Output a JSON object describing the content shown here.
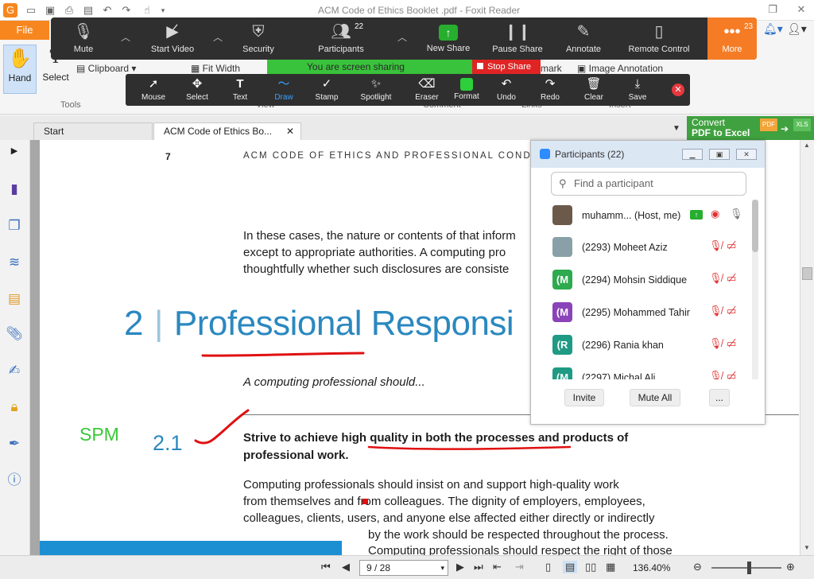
{
  "app": {
    "title": "ACM Code of Ethics Booklet .pdf - Foxit Reader",
    "window_controls": [
      "–",
      "❐",
      "×"
    ]
  },
  "ribbon": {
    "file_label": "File",
    "hand_label": "Hand",
    "select_label": "Select",
    "tools_group": "Tools",
    "view_group": "View",
    "comment_group": "Comment",
    "links_group": "Links",
    "insert_group": "Insert",
    "clipboard_label": "Clipboard",
    "fit_width_label": "Fit Width",
    "bookmark_label": "mark",
    "image_annotation_label": "Image Annotation"
  },
  "zoom": {
    "mute": "Mute",
    "start_video": "Start Video",
    "security": "Security",
    "participants": "Participants",
    "participants_count": "22",
    "new_share": "New Share",
    "pause_share": "Pause Share",
    "annotate": "Annotate",
    "remote_control": "Remote Control",
    "more": "More",
    "more_count": "23",
    "sharing_banner": "You are screen sharing",
    "stop_share": "Stop Share"
  },
  "annotation_toolbar": {
    "tools": [
      "Mouse",
      "Select",
      "Text",
      "Draw",
      "Stamp",
      "Spotlight",
      "Eraser",
      "Format",
      "Undo",
      "Redo",
      "Clear",
      "Save"
    ],
    "active": "Draw"
  },
  "tabs": {
    "start": "Start",
    "doc": "ACM Code of Ethics Bo..."
  },
  "convert_banner": {
    "line1": "Convert",
    "line2": "PDF to Excel",
    "pdf_badge": "PDF",
    "xls_badge": "XLS"
  },
  "document": {
    "page_number": "7",
    "running_head": "ACM CODE OF ETHICS AND PROFESSIONAL COND",
    "para1": [
      "In these cases, the nature or contents of that inform",
      "except to appropriate authorities. A computing pro",
      "thoughtfully whether such disclosures are consiste"
    ],
    "heading_number": "2",
    "heading_text": "Professional Responsi",
    "intro": "A computing professional should...",
    "section_number": "2.1",
    "section_title_line1_a": "Strive to achieve ",
    "section_title_line1_b": "high quality in both the processes",
    "section_title_line1_c": " and products of",
    "section_title_line2": "professional work.",
    "body": [
      "Computing professionals should insist on and support high-quality work",
      "from themselves and from colleagues. The dignity of employers, employees,",
      "colleagues, clients, users, and anyone else affected either directly or indirectly",
      "by the work should be respected throughout the process.",
      "Computing professionals should respect the right of those"
    ],
    "handwritten_note": "SPM",
    "ink_color": "#e01010",
    "note_color": "#37c837"
  },
  "participants_panel": {
    "title": "Participants (22)",
    "search_placeholder": "Find a participant",
    "participants": [
      {
        "name": "muhamm...  (Host, me)",
        "avatar": "",
        "avatar_color": "#6b5a4a"
      },
      {
        "name": "(2293) Moheet Aziz",
        "avatar": "",
        "avatar_color": "#8aa0a8"
      },
      {
        "name": "(2294) Mohsin Siddique",
        "avatar": "(M",
        "avatar_color": "#2eaa4f"
      },
      {
        "name": "(2295) Mohammed Tahir",
        "avatar": "(M",
        "avatar_color": "#8a43b8"
      },
      {
        "name": "(2296) Rania khan",
        "avatar": "(R",
        "avatar_color": "#1f9a84"
      },
      {
        "name": "(2297) Michal Ali",
        "avatar": "(M",
        "avatar_color": "#1f9a84"
      }
    ],
    "invite": "Invite",
    "mute_all": "Mute All",
    "more": "..."
  },
  "status": {
    "page_field": "9 / 28",
    "zoom_level": "136.40%"
  }
}
